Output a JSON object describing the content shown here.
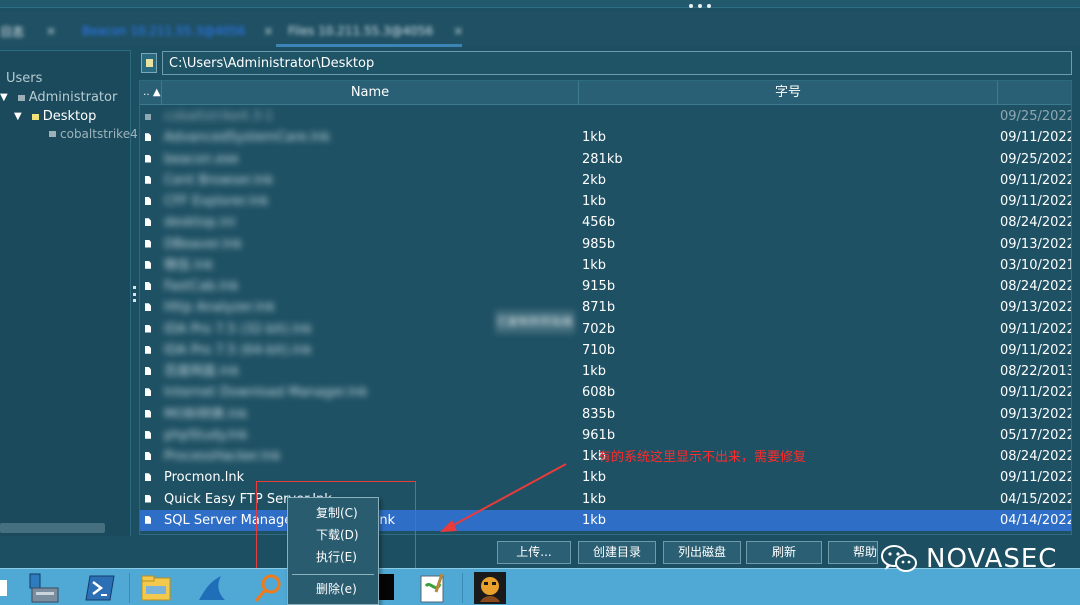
{
  "tabs": [
    {
      "label": "日志",
      "color": "#ffffff"
    },
    {
      "label": "Beacon 10.211.55.3@4056",
      "color": "#2f7bff"
    },
    {
      "label": "Files 10.211.55.3@4056",
      "color": "#d6e4ea"
    }
  ],
  "tree": {
    "users": "Users",
    "administrator": "Administrator",
    "desktop": "Desktop",
    "cobalt": "cobaltstrike4"
  },
  "path": {
    "value": "C:\\Users\\Administrator\\Desktop"
  },
  "table": {
    "columns": {
      "name": "Name",
      "size": "字号"
    },
    "rows": [
      {
        "name": "cobaltstrike4.3-1",
        "size": "",
        "date": "09/25/2022",
        "folder": true,
        "blur": true,
        "dim": true
      },
      {
        "name": "AdvancedSystemCare.lnk",
        "size": "1kb",
        "date": "09/11/2022",
        "blur": true
      },
      {
        "name": "beacon.exe",
        "size": "281kb",
        "date": "09/25/2022",
        "blur": true
      },
      {
        "name": "Cent Browser.lnk",
        "size": "2kb",
        "date": "09/11/2022",
        "blur": true
      },
      {
        "name": "CFF Explorer.lnk",
        "size": "1kb",
        "date": "09/11/2022",
        "blur": true
      },
      {
        "name": "desktop.ini",
        "size": "456b",
        "date": "08/24/2022",
        "blur": true
      },
      {
        "name": "DBeaver.lnk",
        "size": "985b",
        "date": "09/13/2022",
        "blur": true
      },
      {
        "name": "微信.lnk",
        "size": "1kb",
        "date": "03/10/2021",
        "blur": true
      },
      {
        "name": "FastCab.lnk",
        "size": "915b",
        "date": "08/24/2022",
        "blur": true
      },
      {
        "name": "Http Analyzer.lnk",
        "size": "871b",
        "date": "09/13/2022",
        "blur": true
      },
      {
        "name": "IDA Pro 7.5 (32-bit).lnk",
        "size": "702b",
        "date": "09/11/2022",
        "blur": true
      },
      {
        "name": "IDA Pro 7.5 (64-bit).lnk",
        "size": "710b",
        "date": "09/11/2022",
        "blur": true
      },
      {
        "name": "百度网盘.lnk",
        "size": "1kb",
        "date": "08/22/2013",
        "blur": true
      },
      {
        "name": "Internet Download Manager.lnk",
        "size": "608b",
        "date": "09/11/2022",
        "blur": true
      },
      {
        "name": "MOBI转换.lnk",
        "size": "835b",
        "date": "09/13/2022",
        "blur": true
      },
      {
        "name": "phpStudy.lnk",
        "size": "961b",
        "date": "05/17/2022",
        "blur": true
      },
      {
        "name": "ProcessHacker.lnk",
        "size": "1kb",
        "date": "08/24/2022",
        "blur": true
      },
      {
        "name": "Procmon.lnk",
        "size": "1kb",
        "date": "09/11/2022"
      },
      {
        "name": "Quick Easy FTP Server.lnk",
        "size": "1kb",
        "date": "04/15/2022"
      },
      {
        "name": "SQL Server Management Studio.lnk",
        "size": "1kb",
        "date": "04/14/2022",
        "selected": true
      }
    ]
  },
  "overlay_tip": "已复制到剪贴板",
  "annotation": {
    "text": "有的系统这里显示不出来，需要修复",
    "color": "#ff2a2a"
  },
  "buttons": {
    "upload": "上传...",
    "mkdir": "创建目录",
    "list_drives": "列出磁盘",
    "refresh": "刷新",
    "help": "帮助"
  },
  "context_menu": {
    "copy": "复制(C)",
    "download": "下载(D)",
    "execute": "执行(E)",
    "delete": "删除(e)"
  },
  "watermark": "NOVASEC",
  "colors": {
    "selected": "#2e6ec6",
    "background": "#1d4f62",
    "taskbar": "#4fa9d4"
  }
}
